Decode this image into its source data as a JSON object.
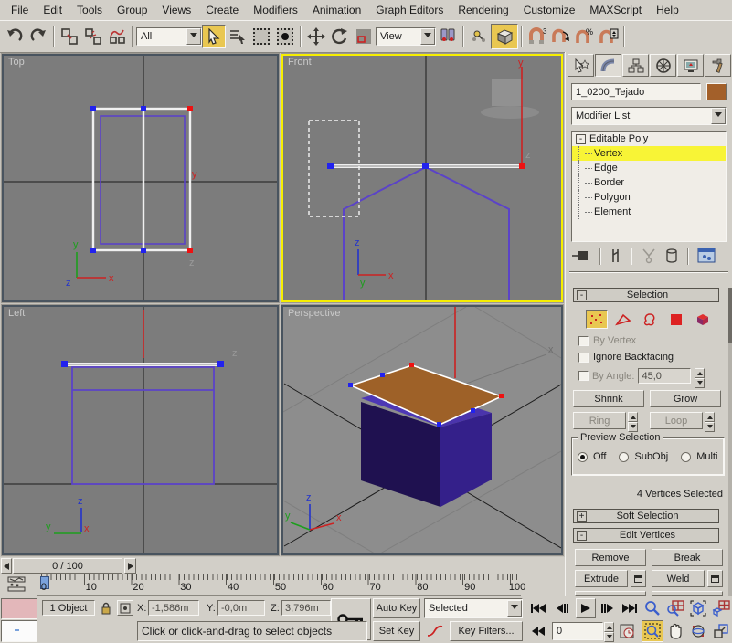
{
  "menubar": {
    "items": [
      "File",
      "Edit",
      "Tools",
      "Group",
      "Views",
      "Create",
      "Modifiers",
      "Animation",
      "Graph Editors",
      "Rendering",
      "Customize",
      "MAXScript",
      "Help"
    ]
  },
  "toolbar": {
    "selection_filter": "All",
    "coordinate_system": "View",
    "highlight_color": "#e9c751"
  },
  "viewports": {
    "top": {
      "label": "Top"
    },
    "front": {
      "label": "Front",
      "active": true,
      "active_border_color": "#f6ee00"
    },
    "left": {
      "label": "Left"
    },
    "perspective": {
      "label": "Perspective"
    },
    "axis": {
      "x": "x",
      "y": "y",
      "z": "z"
    },
    "wire_color": "#5b43c8",
    "roof_color": "#9e6128",
    "selected_vertex_color": "#ee1111",
    "vertex_color": "#2222ee"
  },
  "command_panel": {
    "object_name": "1_0200_Tejado",
    "object_color": "#a3602a",
    "modifier_list": "Modifier List",
    "stack": {
      "expand_glyph": "-",
      "root": "Editable Poly",
      "items": [
        "Vertex",
        "Edge",
        "Border",
        "Polygon",
        "Element"
      ],
      "selected": "Vertex",
      "highlight_color": "#f8f436"
    },
    "selection": {
      "glyph": "-",
      "title": "Selection",
      "by_vertex": "By Vertex",
      "ignore_backfacing": "Ignore Backfacing",
      "by_angle": "By Angle:",
      "angle_value": "45,0",
      "shrink": "Shrink",
      "grow": "Grow",
      "ring": "Ring",
      "loop": "Loop",
      "preview_title": "Preview Selection",
      "options": [
        "Off",
        "SubObj",
        "Multi"
      ],
      "status": "4 Vertices Selected"
    },
    "soft_selection": {
      "glyph": "+",
      "title": "Soft Selection"
    },
    "edit_vertices": {
      "glyph": "-",
      "title": "Edit Vertices",
      "buttons": [
        "Remove",
        "Break",
        "Extrude",
        "Weld"
      ]
    }
  },
  "timeline": {
    "slider": "0 / 100",
    "ticks": [
      "0",
      "10",
      "20",
      "30",
      "40",
      "50",
      "60",
      "70",
      "80",
      "90",
      "100"
    ],
    "current_frame_marker_color": "#7aa2dc"
  },
  "status_bar": {
    "object_count": "1 Object",
    "x_label": "X:",
    "x_value": "-1,586m",
    "y_label": "Y:",
    "y_value": "-0,0m",
    "z_label": "Z:",
    "z_value": "3,796m",
    "prompt": "Click or click-and-drag to select objects",
    "auto_key": "Auto Key",
    "set_key": "Set Key",
    "key_filter_mode": "Selected",
    "key_filters": "Key Filters...",
    "frame": "0"
  }
}
